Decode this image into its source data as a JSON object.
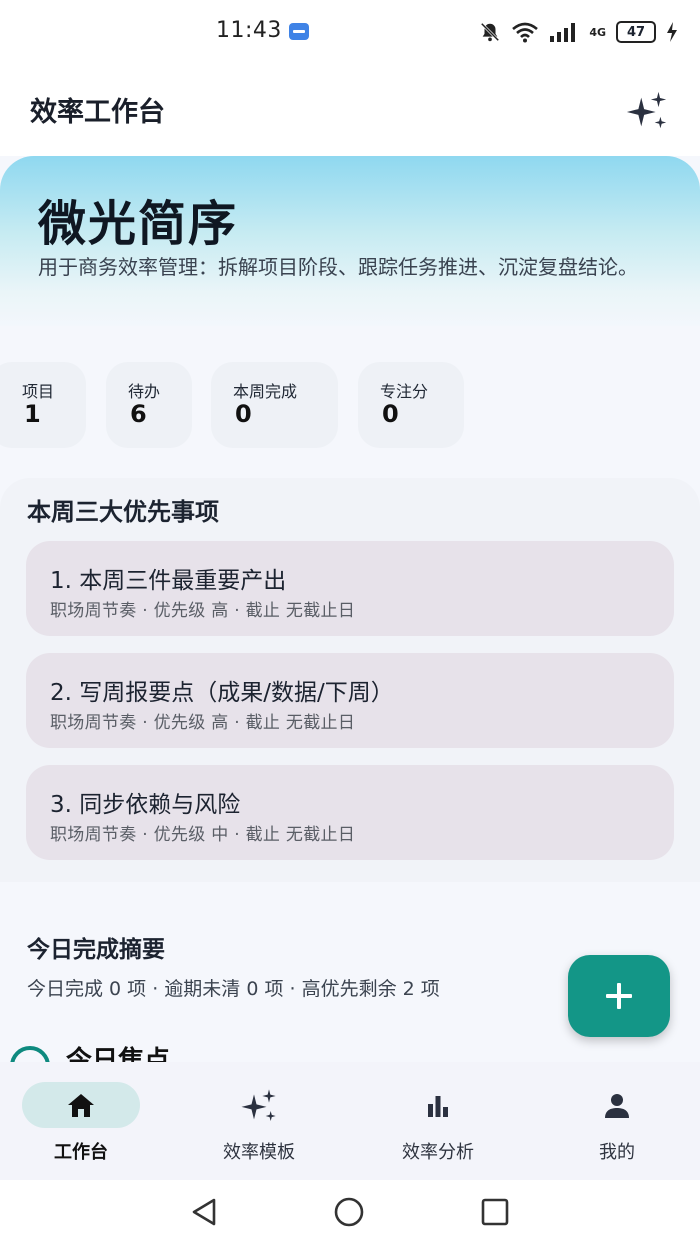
{
  "status_bar": {
    "time": "11:43",
    "battery": "47",
    "network_label": "4G",
    "icons": [
      "usb-icon",
      "bell-off-icon",
      "wifi-icon",
      "signal-icon",
      "battery-icon",
      "charging-icon"
    ]
  },
  "header": {
    "title": "效率工作台",
    "action_icon": "sparkle-icon"
  },
  "hero": {
    "title": "微光简序",
    "description": "用于商务效率管理：拆解项目阶段、跟踪任务推进、沉淀复盘结论。"
  },
  "stats": [
    {
      "label": "项目",
      "value": "1"
    },
    {
      "label": "待办",
      "value": "6"
    },
    {
      "label": "本周完成",
      "value": "0"
    },
    {
      "label": "专注分",
      "value": "0"
    }
  ],
  "priorities": {
    "title": "本周三大优先事项",
    "items": [
      {
        "title": "1. 本周三件最重要产出",
        "meta": "职场周节奏 · 优先级 高 · 截止 无截止日"
      },
      {
        "title": "2. 写周报要点（成果/数据/下周）",
        "meta": "职场周节奏 · 优先级 高 · 截止 无截止日"
      },
      {
        "title": "3. 同步依赖与风险",
        "meta": "职场周节奏 · 优先级 中 · 截止 无截止日"
      }
    ]
  },
  "summary": {
    "title": "今日完成摘要",
    "text": "今日完成 0 项 · 逾期未清 0 项 · 高优先剩余 2 项",
    "next_section_title": "今日焦点"
  },
  "fab": {
    "icon": "plus-icon"
  },
  "bottom_nav": [
    {
      "label": "工作台",
      "icon": "home-icon",
      "active": true
    },
    {
      "label": "效率模板",
      "icon": "sparkle-icon",
      "active": false
    },
    {
      "label": "效率分析",
      "icon": "bar-chart-icon",
      "active": false
    },
    {
      "label": "我的",
      "icon": "person-icon",
      "active": false
    }
  ],
  "colors": {
    "accent": "#139687",
    "hero_top": "#8fd8f0",
    "task_bg": "#e7e2ea",
    "nav_active_pill": "#d3e9ea"
  }
}
